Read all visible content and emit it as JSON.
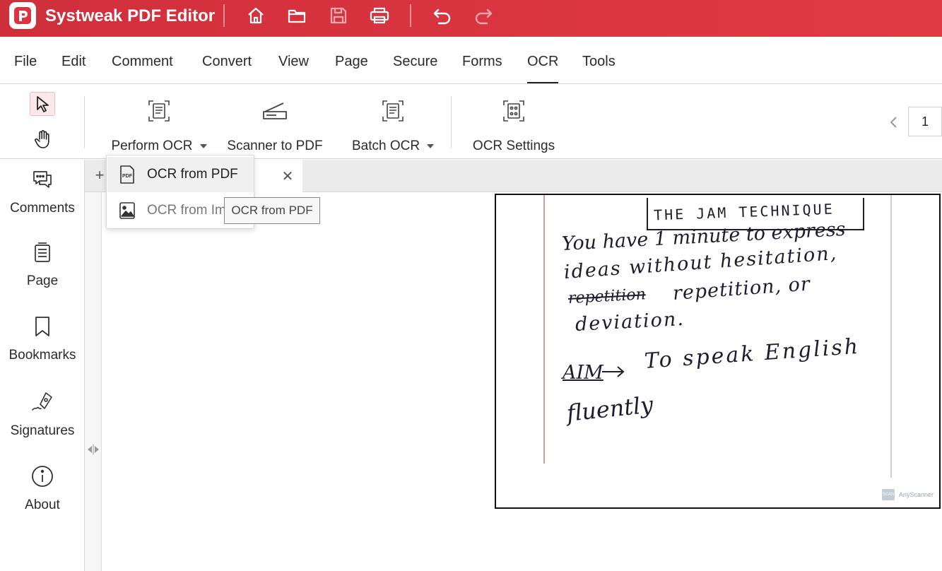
{
  "app": {
    "title": "Systweak PDF Editor"
  },
  "colors": {
    "brand": "#d9343f",
    "accent_selected": "#fde8ea"
  },
  "quick_toolbar": {
    "icons": [
      "home-icon",
      "folder-icon",
      "save-icon",
      "print-icon",
      "undo-icon",
      "redo-icon"
    ]
  },
  "menu": {
    "items": [
      "File",
      "Edit",
      "Comment",
      "Convert",
      "View",
      "Page",
      "Secure",
      "Forms",
      "OCR",
      "Tools"
    ],
    "active": "OCR"
  },
  "ribbon": {
    "perform_ocr": "Perform OCR",
    "scanner_to_pdf": "Scanner to PDF",
    "batch_ocr": "Batch OCR",
    "ocr_settings": "OCR Settings"
  },
  "pager": {
    "current_page": "1"
  },
  "sidebar": {
    "comments": "Comments",
    "page": "Page",
    "bookmarks": "Bookmarks",
    "signatures": "Signatures",
    "about": "About"
  },
  "tabs": {
    "add": "+",
    "close": "✕"
  },
  "dropdown": {
    "ocr_from_pdf": "OCR from PDF",
    "ocr_from_image": "OCR from Image",
    "pdf_badge": "PDF"
  },
  "tooltip": {
    "text": "OCR from PDF"
  },
  "document": {
    "heading": "THE JAM TECHNIQUE",
    "line1": "You have 1 minute to express",
    "line2": "ideas without hesitation,",
    "line3_struck": "repetition",
    "line3": "repetition, or",
    "line4": "deviation.",
    "aim_label": "AIM",
    "aim_text": "To speak English",
    "line6": "fluently",
    "watermark": "AnyScanner",
    "watermark_badge": "SCAN"
  }
}
